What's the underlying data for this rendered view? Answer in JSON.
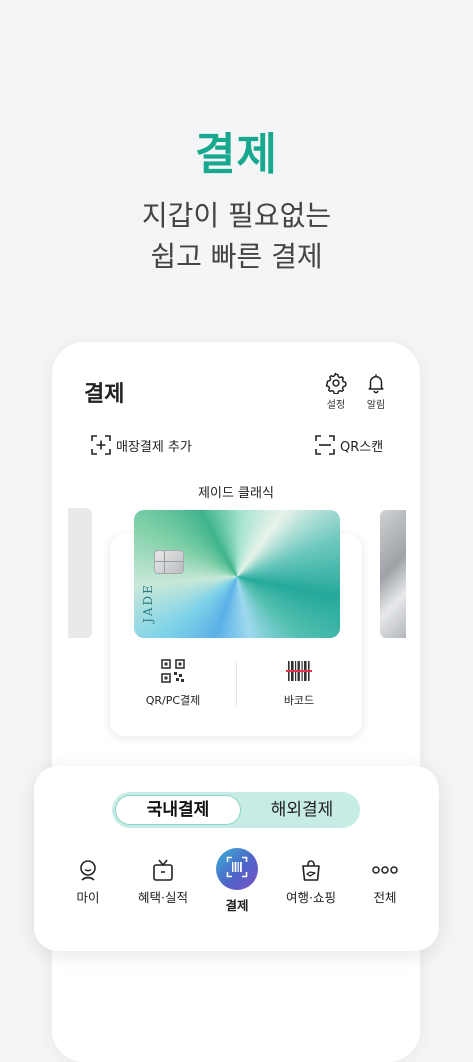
{
  "hero": {
    "title": "결제",
    "subtitle_line1": "지갑이 필요없는",
    "subtitle_line2": "쉽고 빠른 결제"
  },
  "header": {
    "title": "결제",
    "settings_label": "설정",
    "alarm_label": "알림"
  },
  "actions": {
    "add_store_payment": "매장결제 추가",
    "qr_scan": "QR스캔"
  },
  "card": {
    "name": "제이드 클래식",
    "brand_text": "JADE"
  },
  "card_buttons": {
    "qr_pc": "QR/PC결제",
    "barcode": "바코드"
  },
  "payment_toggle": {
    "domestic": "국내결제",
    "overseas": "해외결제",
    "selected": "국내결제"
  },
  "bottom_nav": [
    {
      "label": "마이",
      "icon": "user-icon"
    },
    {
      "label": "혜택·실적",
      "icon": "gift-icon"
    },
    {
      "label": "결제",
      "icon": "barcode-scan-icon",
      "active": true
    },
    {
      "label": "여행·쇼핑",
      "icon": "shopping-bag-icon"
    },
    {
      "label": "전체",
      "icon": "more-icon"
    }
  ],
  "colors": {
    "accent": "#17a98f",
    "toggle_bg": "#c7ece6"
  }
}
